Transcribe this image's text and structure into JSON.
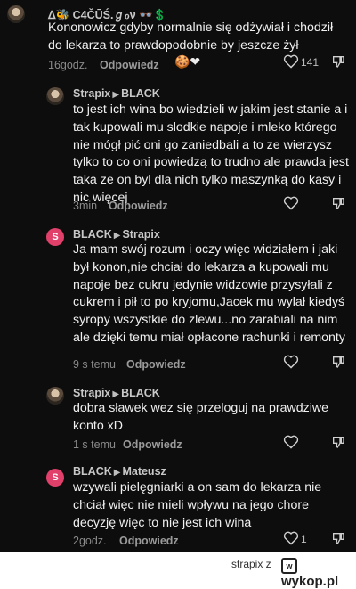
{
  "c0": {
    "author": "ᐃ🐝 C4ČŪŚ.ℊℴν 👓💲",
    "text": "Kononowicz gdyby normalnie się odżywiał i chodził do lekarza to prawdopodobnie by jeszcze żył",
    "time": "16godz.",
    "reply": "Odpowiedz",
    "likes": "141"
  },
  "c1": {
    "author": "Strapix",
    "to": "BLACK",
    "text": "to jest ich wina bo wiedzieli w jakim jest stanie a i tak kupowali mu slodkie napoje i mleko którego nie mógł pić oni go zaniedbali a to ze wierzysz tylko to co oni powiedzą to trudno ale prawda jest taka ze on byl dla nich tylko maszynką do kasy i nic więcej",
    "time": "3min",
    "reply": "Odpowiedz"
  },
  "c2": {
    "author": "BLACK",
    "to": "Strapix",
    "text": "Ja mam swój rozum i oczy więc widziałem i jaki był konon,nie chciał do lekarza a kupowali mu napoje bez cukru jedynie widzowie przysyłali z cukrem i pił to po kryjomu,Jacek mu wylał kiedyś syropy wszystkie do zlewu...no zarabiali na nim ale dzięki temu miał opłacone rachunki i remonty",
    "time": "9 s temu",
    "reply": "Odpowiedz",
    "avatar_letter": "S"
  },
  "c3": {
    "author": "Strapix",
    "to": "BLACK",
    "text": "dobra sławek wez się przeloguj na prawdziwe konto xD",
    "time": "1 s temu",
    "reply": "Odpowiedz"
  },
  "c4": {
    "author": "BLACK",
    "to": "Mateusz",
    "text": "wzywali pielęgniarki a on sam do lekarza nie chciał więc nie mieli wpływu na jego chore decyzję więc to nie jest ich wina",
    "time": "2godz.",
    "reply": "Odpowiedz",
    "likes": "1",
    "avatar_letter": "S"
  },
  "footer": {
    "user": "strapix z",
    "brand": "wykop.pl"
  }
}
